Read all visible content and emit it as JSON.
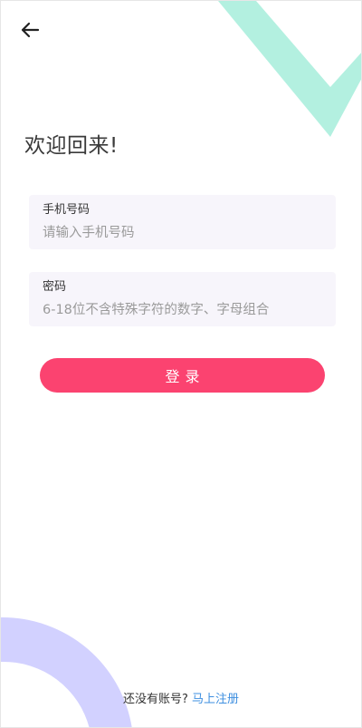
{
  "header": {
    "back_icon": "arrow-left-icon"
  },
  "page": {
    "title": "欢迎回来!"
  },
  "form": {
    "phone": {
      "label": "手机号码",
      "placeholder": "请输入手机号码",
      "value": ""
    },
    "password": {
      "label": "密码",
      "placeholder": "6-18位不含特殊字符的数字、字母组合",
      "value": ""
    },
    "login_label": "登录"
  },
  "footer": {
    "prompt": "还没有账号? ",
    "register_label": "马上注册"
  },
  "colors": {
    "accent": "#fb4370",
    "link": "#3e8fe0",
    "deco_mint": "#b3f0e0",
    "deco_lavender": "#d2d1ff",
    "field_bg": "#f7f5fb"
  }
}
